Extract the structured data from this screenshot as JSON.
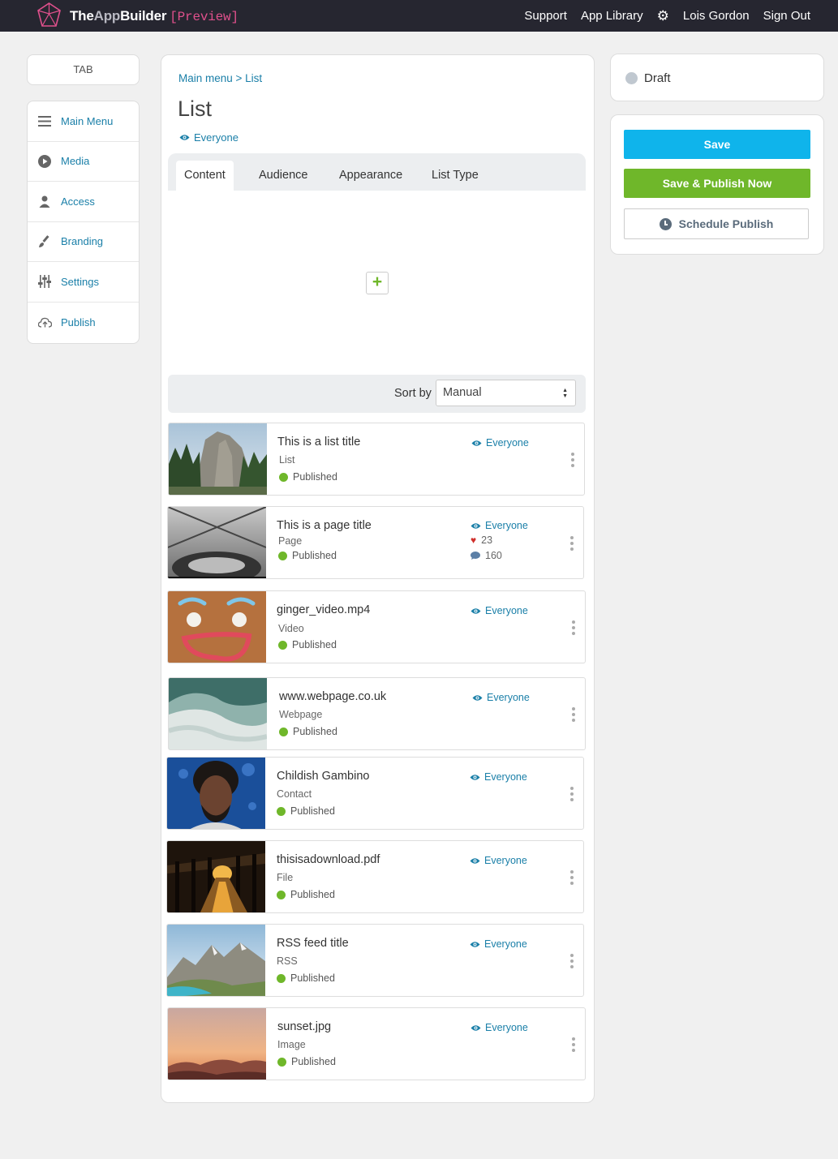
{
  "header": {
    "brand_part1": "The",
    "brand_part2": "App",
    "brand_part3": "Builder",
    "brand_tag": "[Preview]",
    "nav": {
      "support": "Support",
      "app_library": "App Library",
      "settings_icon": "gear-icon",
      "user": "Lois Gordon",
      "sign_out": "Sign Out"
    }
  },
  "tab_label": "TAB",
  "sidebar": {
    "items": [
      {
        "label": "Main Menu",
        "icon": "menu-lines-icon"
      },
      {
        "label": "Media",
        "icon": "play-circle-icon"
      },
      {
        "label": "Access",
        "icon": "user-icon"
      },
      {
        "label": "Branding",
        "icon": "brush-icon"
      },
      {
        "label": "Settings",
        "icon": "sliders-icon"
      },
      {
        "label": "Publish",
        "icon": "cloud-upload-icon"
      }
    ]
  },
  "main": {
    "breadcrumb": "Main menu > List",
    "title": "List",
    "audience": "Everyone",
    "tabs": [
      {
        "label": "Content",
        "active": true
      },
      {
        "label": "Audience"
      },
      {
        "label": "Appearance"
      },
      {
        "label": "List Type"
      }
    ],
    "add_label": "+",
    "sort_label": "Sort by",
    "sort_value": "Manual",
    "items": [
      {
        "title": "This is a list title",
        "type": "List",
        "status": "Published",
        "audience": "Everyone"
      },
      {
        "title": "This is a page title",
        "type": "Page",
        "status": "Published",
        "audience": "Everyone",
        "likes": "23",
        "comments": "160"
      },
      {
        "title": "ginger_video.mp4",
        "type": "Video",
        "status": "Published",
        "audience": "Everyone"
      },
      {
        "title": "www.webpage.co.uk",
        "type": "Webpage",
        "status": "Published",
        "audience": "Everyone"
      },
      {
        "title": "Childish Gambino",
        "type": "Contact",
        "status": "Published",
        "audience": "Everyone"
      },
      {
        "title": "thisisadownload.pdf",
        "type": "File",
        "status": "Published",
        "audience": "Everyone"
      },
      {
        "title": "RSS feed title",
        "type": "RSS",
        "status": "Published",
        "audience": "Everyone"
      },
      {
        "title": "sunset.jpg",
        "type": "Image",
        "status": "Published",
        "audience": "Everyone"
      }
    ]
  },
  "status_panel": {
    "state": "Draft"
  },
  "actions": {
    "save": "Save",
    "save_publish": "Save & Publish Now",
    "schedule": "Schedule Publish"
  },
  "colors": {
    "topbar": "#262630",
    "link": "#1a7fa8",
    "save": "#0fb4eb",
    "publish": "#6fb72a",
    "brand_tag": "#e0508c"
  }
}
